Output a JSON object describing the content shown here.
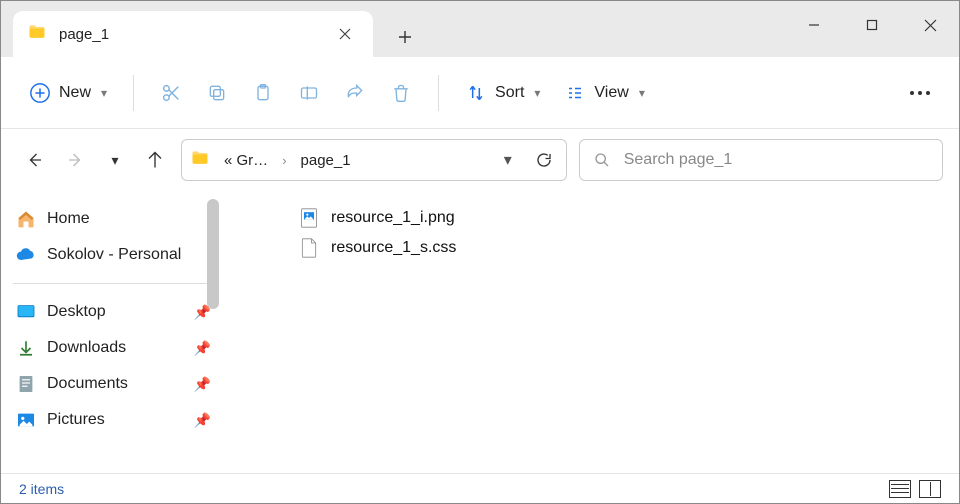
{
  "window": {
    "tab_title": "page_1",
    "new_button_label": "New",
    "sort_label": "Sort",
    "view_label": "View"
  },
  "breadcrumb": {
    "root_abbrev": "«  Gr…",
    "current": "page_1"
  },
  "search": {
    "placeholder": "Search page_1"
  },
  "sidebar": {
    "home": "Home",
    "onedrive": "Sokolov - Personal",
    "quick": [
      {
        "label": "Desktop"
      },
      {
        "label": "Downloads"
      },
      {
        "label": "Documents"
      },
      {
        "label": "Pictures"
      }
    ]
  },
  "files": [
    {
      "name": "resource_1_i.png",
      "kind": "image"
    },
    {
      "name": "resource_1_s.css",
      "kind": "file"
    }
  ],
  "status": {
    "count_text": "2 items"
  }
}
